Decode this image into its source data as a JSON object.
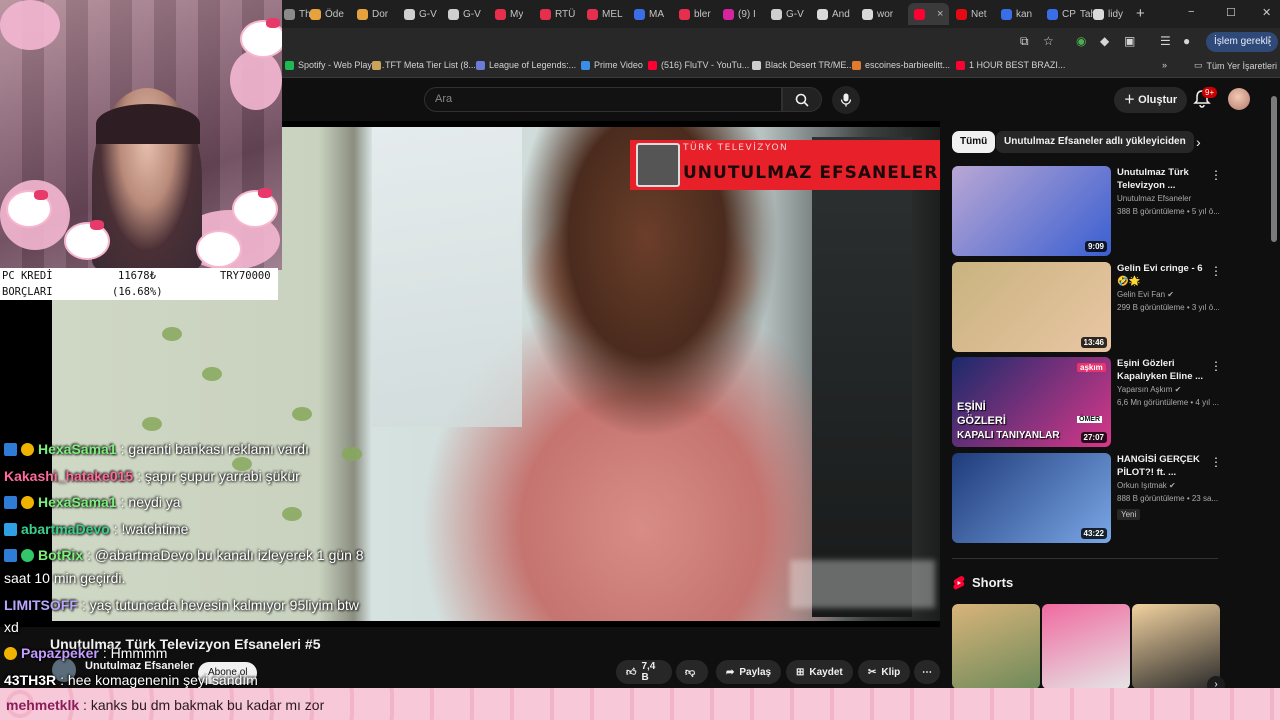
{
  "browser": {
    "tabs": [
      {
        "label": "The",
        "color": "#8a8a8a"
      },
      {
        "label": "Öde",
        "color": "#e6a23c"
      },
      {
        "label": "Dor",
        "color": "#e6a23c"
      },
      {
        "label": "G-V",
        "color": "#cfcfcf"
      },
      {
        "label": "G-V",
        "color": "#cfcfcf"
      },
      {
        "label": "My",
        "color": "#e62e4d"
      },
      {
        "label": "RTÜ",
        "color": "#e62e4d"
      },
      {
        "label": "MEL",
        "color": "#e62e4d"
      },
      {
        "label": "MA",
        "color": "#3a6ee8"
      },
      {
        "label": "bler",
        "color": "#e62e4d"
      },
      {
        "label": "(9) I",
        "color": "#d6249f"
      },
      {
        "label": "G-V",
        "color": "#cfcfcf"
      },
      {
        "label": "And",
        "color": "#dadada"
      },
      {
        "label": "wor",
        "color": "#dadada"
      },
      {
        "label": "",
        "color": "#ff0033",
        "active": true
      },
      {
        "label": "Net",
        "color": "#e50914"
      },
      {
        "label": "kan",
        "color": "#3a6ee8"
      },
      {
        "label": "Tah",
        "color": "#3a6ee8"
      },
      {
        "label": "lidy",
        "color": "#dadada"
      }
    ],
    "tab_prefix_cp": "CP",
    "tab_close": "×",
    "new_tab": "+",
    "window_controls": [
      "−",
      "☐",
      "✕"
    ],
    "profile_label": "İşlem gerekli",
    "bookmarks": [
      {
        "label": "Spotify - Web Playe...",
        "color": "#1db954"
      },
      {
        "label": "TFT Meta Tier List (8...",
        "color": "#c9a45a"
      },
      {
        "label": "League of Legends:...",
        "color": "#6b7bd6"
      },
      {
        "label": "Prime Video",
        "color": "#3a8ee8"
      },
      {
        "label": "(516) FluTV - YouTu...",
        "color": "#ff0033"
      },
      {
        "label": "Black Desert TR/ME...",
        "color": "#cfcfcf"
      },
      {
        "label": "escoines-barbieelitt...",
        "color": "#e07a2f"
      },
      {
        "label": "1 HOUR BEST BRAZI...",
        "color": "#ff0033"
      }
    ],
    "bookmarks_overflow": "»",
    "all_bookmarks": "Tüm Yer İşaretleri"
  },
  "youtube": {
    "search_placeholder": "Ara",
    "create_label": "Oluştur",
    "notif_count": "9+",
    "video": {
      "logo_sub": "TÜRK TELEVİZYON",
      "logo_title": "UNUTULMAZ EFSANELER",
      "title": "Unutulmaz Türk Televizyon Efsaneleri #5",
      "channel": "Unutulmaz Efsaneler",
      "subscribe": "Abone ol",
      "likes": "7,4 B",
      "share": "Paylaş",
      "save": "Kaydet",
      "clip": "Klip",
      "more": "⋯"
    },
    "chips": [
      {
        "label": "Tümü",
        "selected": true
      },
      {
        "label": "Unutulmaz Efsaneler adlı yükleyiciden",
        "selected": false
      }
    ],
    "chip_next": "›",
    "recommendations": [
      {
        "title": "Unutulmaz Türk Televizyon ...",
        "channel": "Unutulmaz Efsaneler",
        "meta": "388 B görüntüleme • 5 yıl ö...",
        "duration": "9:09",
        "verified": false,
        "badge": "",
        "thumb_a": "#b9a7d4",
        "thumb_b": "#3a5fd1"
      },
      {
        "title": "Gelin Evi cringe - 6 🤣🌟",
        "channel": "Gelin Evi Fan",
        "meta": "299 B görüntüleme • 3 yıl ö...",
        "duration": "13:46",
        "verified": true,
        "badge": "",
        "thumb_a": "#c9b37f",
        "thumb_b": "#e9c6a4"
      },
      {
        "title": "Eşini Gözleri Kapalıyken Eline ...",
        "channel": "Yaparsın Aşkım",
        "meta": "6,6 Mn görüntüleme • 4 yıl ...",
        "duration": "27:07",
        "verified": true,
        "badge": "",
        "thumb_a": "#1a2a6b",
        "thumb_b": "#d9388a"
      },
      {
        "title": "HANGİSİ GERÇEK PİLOT?! ft. ...",
        "channel": "Orkun Işıtmak",
        "meta": "888 B görüntüleme • 23 sa...",
        "duration": "43:22",
        "verified": true,
        "badge": "Yeni",
        "thumb_a": "#1f3b7a",
        "thumb_b": "#7aa7e6"
      }
    ],
    "thumb_text": {
      "line1": "EŞİNİ",
      "line2": "GÖZLERİ",
      "line3": "KAPALI TANIYANLAR",
      "name": "ÖMER",
      "brand": "aşkım"
    },
    "shorts_title": "Shorts",
    "shorts_next": "›",
    "shorts": [
      {
        "color_a": "#d8b47a",
        "color_b": "#6e8a5a"
      },
      {
        "color_a": "#f06aa0",
        "color_b": "#e5e5e5"
      },
      {
        "color_a": "#f2d2a0",
        "color_b": "#2a2a2a"
      }
    ],
    "menu_kebab": "⋮"
  },
  "stream_overlay": {
    "stat_row1": {
      "label": "PC KREDİ",
      "value": "11678₺",
      "target": "TRY70000"
    },
    "stat_row2": {
      "label": "BORÇLARI",
      "value": "(16.68%)"
    },
    "chat": [
      {
        "name": "HexaSama1",
        "text": ": garanti bankası reklamı vardı",
        "name_color": "#7cf07c",
        "badges": [
          "prime",
          "sub"
        ]
      },
      {
        "name": "Kakashi_hatake015",
        "text": ": şapır şupur yarrabi şükür",
        "name_color": "#ff6b9a",
        "badges": []
      },
      {
        "name": "HexaSama1",
        "text": ": neydi ya",
        "name_color": "#7cf07c",
        "badges": [
          "prime",
          "sub"
        ]
      },
      {
        "name": "abartmaDevo",
        "text": ": !watchtime",
        "name_color": "#39d08c",
        "badges": [
          "gem"
        ]
      },
      {
        "name": "BotRix",
        "text": ": @abartmaDevo bu kanalı izleyerek 1 gün 8",
        "name_color": "#7cf07c",
        "badges": [
          "prime",
          "mod"
        ]
      },
      {
        "name": "",
        "text": "saat 10 min geçirdi.",
        "name_color": "#ffffff",
        "badges": []
      },
      {
        "name": "LIMITSOFF",
        "text": ": yaş tutuncada hevesin kalmıyor 95liyim btw",
        "name_color": "#b9a6ff",
        "badges": []
      },
      {
        "name": "",
        "text": "xd",
        "name_color": "#ffffff",
        "badges": []
      },
      {
        "name": "Papazpeker",
        "text": ": Hmmmm",
        "name_color": "#c49bff",
        "badges": [
          "sub"
        ]
      },
      {
        "name": "43TH3R",
        "text": ": hee komagenenin şeyi sandım",
        "name_color": "#ffffff",
        "badges": []
      }
    ],
    "bottom_chat": {
      "name": "mehmetklk",
      "text": ": kanks bu dm bakmak bu kadar mı zor"
    }
  }
}
